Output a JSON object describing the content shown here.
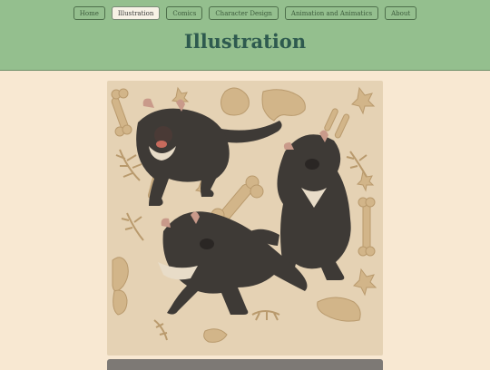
{
  "nav": {
    "items": [
      {
        "label": "Home",
        "active": false
      },
      {
        "label": "Illustration",
        "active": true
      },
      {
        "label": "Comics",
        "active": false
      },
      {
        "label": "Character Design",
        "active": false
      },
      {
        "label": "Animation and Animatics",
        "active": false
      },
      {
        "label": "About",
        "active": false
      }
    ]
  },
  "page": {
    "title": "Illustration"
  },
  "colors": {
    "header_bg": "#94bf8e",
    "page_bg": "#f8e8d2",
    "title": "#2e5a4f",
    "artwork_bg": "#e5d2b4",
    "devil_fur": "#3e3a36",
    "bone": "#d2b589"
  }
}
